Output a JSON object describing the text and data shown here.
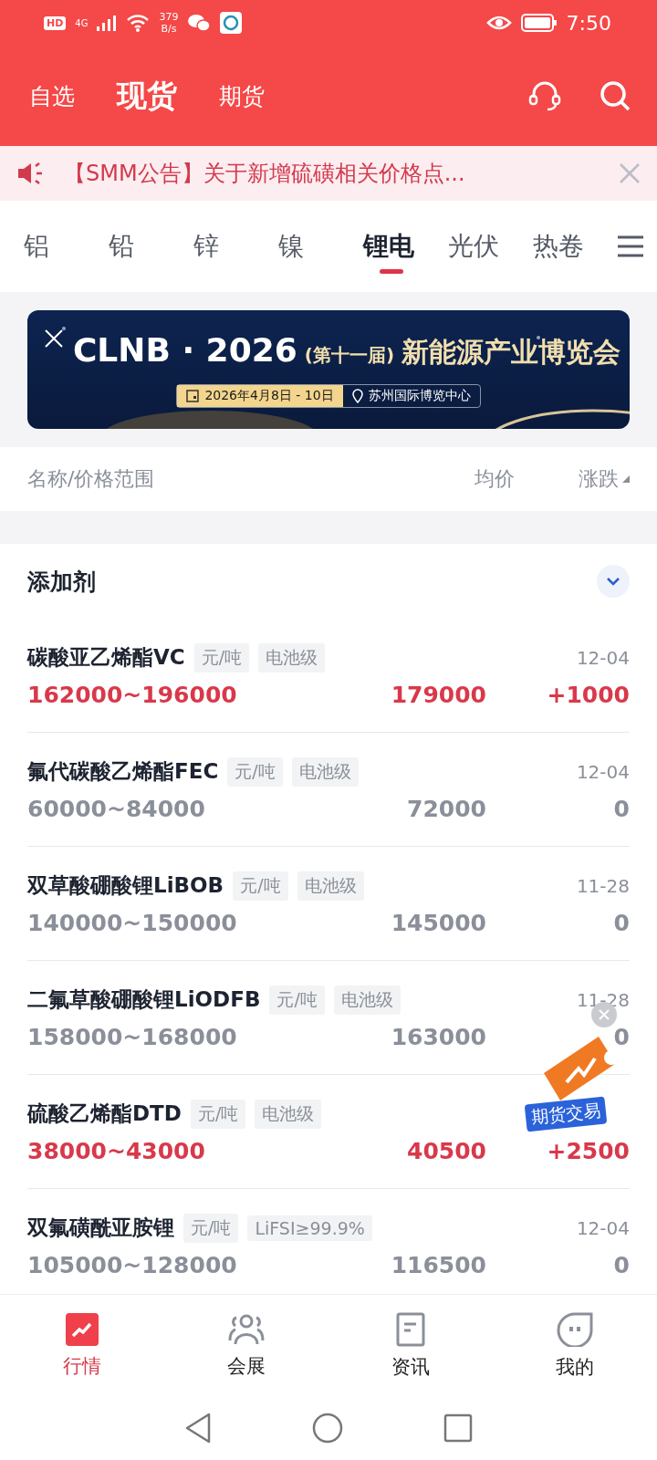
{
  "status_bar": {
    "hd": "HD",
    "network": "4G",
    "speed_value": "379",
    "speed_unit": "B/s",
    "time": "7:50"
  },
  "header": {
    "tabs": [
      {
        "label": "自选",
        "selected": false
      },
      {
        "label": "现货",
        "selected": true
      },
      {
        "label": "期货",
        "selected": false
      }
    ]
  },
  "notice": {
    "text": "【SMM公告】关于新增硫磺相关价格点..."
  },
  "categories": [
    {
      "label": "铝",
      "selected": false
    },
    {
      "label": "铅",
      "selected": false
    },
    {
      "label": "锌",
      "selected": false
    },
    {
      "label": "镍",
      "selected": false
    },
    {
      "label": "锂电",
      "selected": true
    },
    {
      "label": "光伏",
      "selected": false
    },
    {
      "label": "热卷",
      "selected": false
    }
  ],
  "banner": {
    "logo": "CLNB · 2026",
    "edition": "(第十一届)",
    "title": "新能源产业博览会",
    "date": "2026年4月8日 - 10日",
    "venue": "苏州国际博览中心"
  },
  "list_header": {
    "name": "名称/价格范围",
    "average": "均价",
    "change": "涨跌"
  },
  "section": {
    "title": "添加剂",
    "expanded": true
  },
  "rows": [
    {
      "name": "碳酸亚乙烯酯VC",
      "tags": [
        "元/吨",
        "电池级"
      ],
      "date": "12-04",
      "range": "162000~196000",
      "average": "179000",
      "change": "+1000",
      "up": true
    },
    {
      "name": "氟代碳酸乙烯酯FEC",
      "tags": [
        "元/吨",
        "电池级"
      ],
      "date": "12-04",
      "range": "60000~84000",
      "average": "72000",
      "change": "0",
      "up": false
    },
    {
      "name": "双草酸硼酸锂LiBOB",
      "tags": [
        "元/吨",
        "电池级"
      ],
      "date": "11-28",
      "range": "140000~150000",
      "average": "145000",
      "change": "0",
      "up": false
    },
    {
      "name": "二氟草酸硼酸锂LiODFB",
      "tags": [
        "元/吨",
        "电池级"
      ],
      "date": "11-28",
      "range": "158000~168000",
      "average": "163000",
      "change": "0",
      "up": false
    },
    {
      "name": "硫酸乙烯酯DTD",
      "tags": [
        "元/吨",
        "电池级"
      ],
      "date": "",
      "range": "38000~43000",
      "average": "40500",
      "change": "+2500",
      "up": true
    },
    {
      "name": "双氟磺酰亚胺锂",
      "tags": [
        "元/吨",
        "LiFSI≥99.9%"
      ],
      "date": "12-04",
      "range": "105000~128000",
      "average": "116500",
      "change": "0",
      "up": false
    }
  ],
  "floating_badge": {
    "label": "期货交易"
  },
  "bottom_nav": [
    {
      "label": "行情",
      "selected": true
    },
    {
      "label": "会展",
      "selected": false
    },
    {
      "label": "资讯",
      "selected": false
    },
    {
      "label": "我的",
      "selected": false
    }
  ]
}
